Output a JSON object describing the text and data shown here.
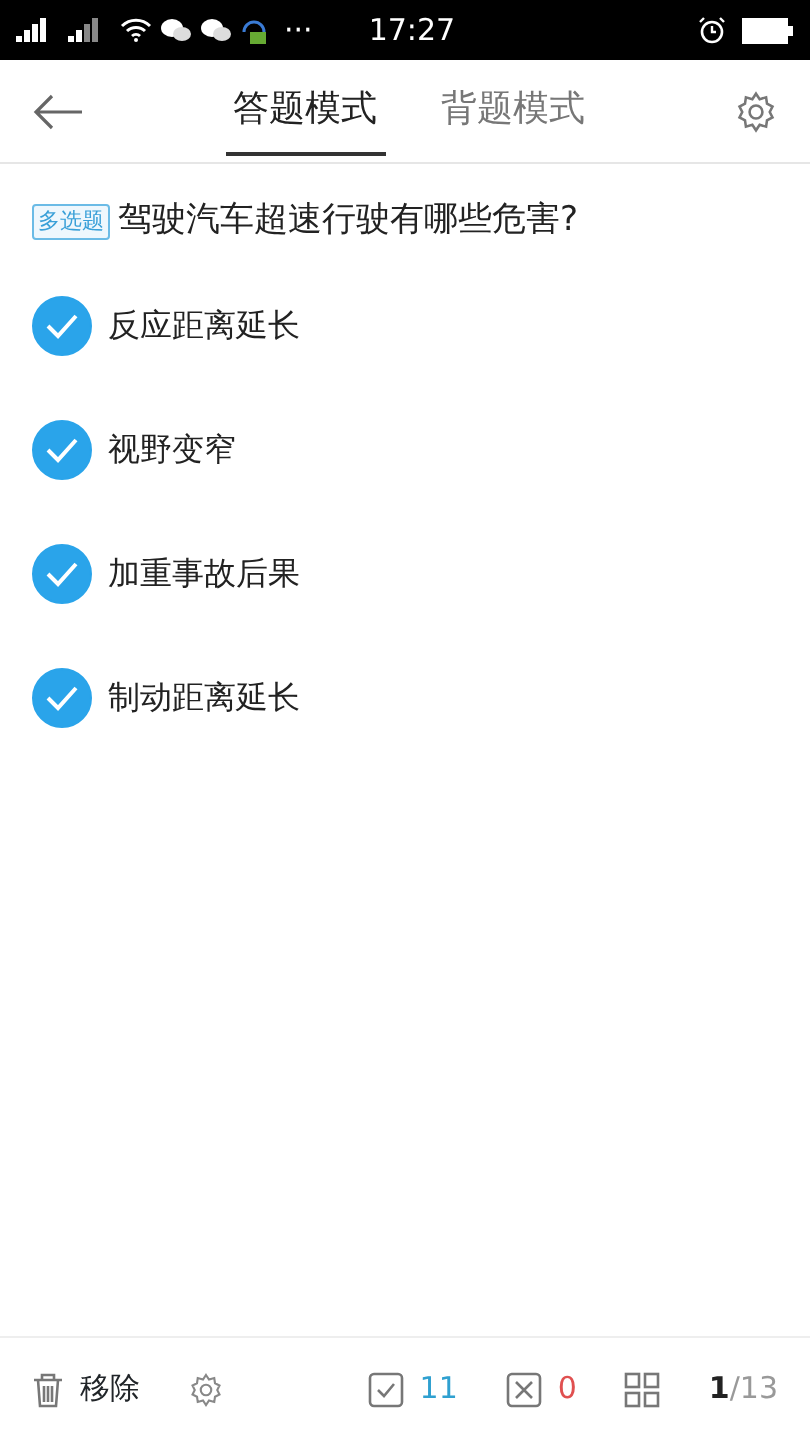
{
  "status_bar": {
    "time": "17:27",
    "dots": "···"
  },
  "tabs": [
    {
      "label": "答题模式",
      "selected": true
    },
    {
      "label": "背题模式",
      "selected": false
    }
  ],
  "question": {
    "tag": "多选题",
    "text": "驾驶汽车超速行驶有哪些危害?"
  },
  "options": [
    {
      "label": "反应距离延长",
      "checked": true
    },
    {
      "label": "视野变窄",
      "checked": true
    },
    {
      "label": "加重事故后果",
      "checked": true
    },
    {
      "label": "制动距离延长",
      "checked": true
    }
  ],
  "footer": {
    "remove": "移除",
    "correct": "11",
    "wrong": "0",
    "progress": "**1**/13"
  }
}
